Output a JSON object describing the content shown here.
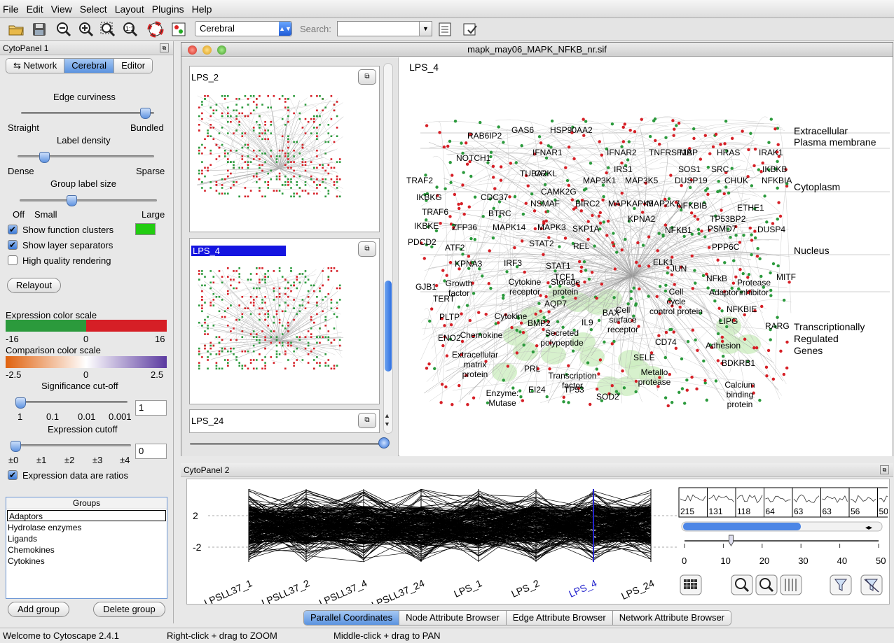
{
  "menu": [
    "File",
    "Edit",
    "View",
    "Select",
    "Layout",
    "Plugins",
    "Help"
  ],
  "toolbar": {
    "layout_combo_value": "Cerebral",
    "search_label": "Search:",
    "search_value": "",
    "icons": [
      "open-folder-icon",
      "save-icon",
      "zoom-out-icon",
      "zoom-in-icon",
      "zoom-selected-icon",
      "zoom-fit-icon",
      "lifebuoy-icon",
      "vizmapper-icon",
      "attribute-browser-icon",
      "export-icon"
    ]
  },
  "left_panel": {
    "title": "CytoPanel 1",
    "tabs": [
      "Network",
      "Cerebral",
      "Editor"
    ],
    "selected_tab": "Cerebral",
    "edge_curviness": {
      "label": "Edge curviness",
      "min_label": "Straight",
      "max_label": "Bundled",
      "value": 0.97
    },
    "label_density": {
      "label": "Label density",
      "min_label": "Dense",
      "max_label": "Sparse",
      "value": 0.17
    },
    "group_label_size": {
      "label": "Group label size",
      "tick_labels": [
        "Off",
        "Small",
        "Large"
      ],
      "value": 0.37
    },
    "show_function_clusters": {
      "label": "Show function clusters",
      "checked": true,
      "swatch_color": "#22cc11"
    },
    "show_layer_separators": {
      "label": "Show layer separators",
      "checked": true
    },
    "high_quality_rendering": {
      "label": "High quality rendering",
      "checked": false
    },
    "relayout_button": "Relayout",
    "expression_color_scale": {
      "label": "Expression color scale",
      "min": "-16",
      "mid": "0",
      "max": "16",
      "low_color": "#2b9a3c",
      "high_color": "#d61f26"
    },
    "comparison_color_scale": {
      "label": "Comparison color scale",
      "min": "-2.5",
      "mid": "0",
      "max": "2.5",
      "low_color": "#e0620f",
      "high_color": "#5b3aa0"
    },
    "significance_cutoff": {
      "label": "Significance cut-off",
      "tick_labels": [
        "1",
        "0.1",
        "0.01",
        "0.001"
      ],
      "value": 0,
      "field_value": "1"
    },
    "expression_cutoff": {
      "label": "Expression cutoff",
      "tick_labels": [
        "±0",
        "±1",
        "±2",
        "±3",
        "±4"
      ],
      "value": 0,
      "field_value": "0"
    },
    "expression_ratios": {
      "label": "Expression data are ratios",
      "checked": true
    },
    "groups": {
      "header": "Groups",
      "items": [
        "Adaptors",
        "Hydrolase enzymes",
        "Ligands",
        "Chemokines",
        "Cytokines"
      ],
      "selected": "Adaptors"
    },
    "add_group_button": "Add group",
    "delete_group_button": "Delete group"
  },
  "network_window": {
    "title": "mapk_may06_MAPK_NFKB_nr.sif",
    "thumbnails": [
      {
        "label": "LPS_2",
        "selected": false
      },
      {
        "label": "LPS_4",
        "selected": true
      },
      {
        "label": "LPS_24",
        "selected": false
      }
    ],
    "canvas_title": "LPS_4",
    "layers": [
      "Extracellular",
      "Plasma membrane",
      "Cytoplasm",
      "Nucleus",
      "Transcriptionally",
      "Regulated",
      "Genes"
    ],
    "genes": [
      "GAS6",
      "HSP90AA2",
      "RAB6IP2",
      "NOTCH1",
      "IFNAR1",
      "IFNAR2",
      "TNFRSF1A",
      "MBP",
      "HRAS",
      "IRAK1",
      "IRS1",
      "SOS1",
      "SRC",
      "IKBKB",
      "TUBA2",
      "CRKL",
      "TRAF2",
      "MAP3K1",
      "MAP3K5",
      "DUSP19",
      "CHUK",
      "NFKBIA",
      "CAMK2G",
      "IKBKG",
      "CDC37",
      "NSMAF",
      "BIRC2",
      "MAPKAPK5",
      "MAP2K7",
      "NFKBIB",
      "ETHE1",
      "TRAF6",
      "BTRC",
      "KPNA2",
      "TP53BP2",
      "IKBKE",
      "ZFP36",
      "MAPK14",
      "MAPK3",
      "SKP1A",
      "NFKB1",
      "PSMD7",
      "DUSP4",
      "PDCD2",
      "STAT2",
      "ATF2",
      "REL",
      "PPP6C",
      "KPNA3",
      "IRF3",
      "STAT1",
      "ELK1",
      "TCF1",
      "MITF",
      "JUN",
      "NFkB",
      "GJB1",
      "TERT",
      "AQP7",
      "BAX",
      "NFKBIE",
      "PLTP",
      "IL9",
      "BMP2",
      "CD74",
      "LIPG",
      "RARG",
      "ENO2",
      "SELE",
      "BDKRB1",
      "PRL",
      "EI24",
      "TP53",
      "SOD2"
    ],
    "clusters": [
      "Growth factor",
      "Cytokine receptor",
      "Storage protein",
      "Cell cycle control protein",
      "Adaptor",
      "Protease inhibitor",
      "Cytokine",
      "Cell surface receptor",
      "Chemokine",
      "Secreted polypeptide",
      "Extracellular matrix protein",
      "Adhesion",
      "Transcription factor",
      "Metallo protease",
      "Enzyme: Mutase",
      "Calcium binding protein"
    ]
  },
  "bottom_panel": {
    "title": "CytoPanel 2",
    "y_ticks": [
      "2",
      "-2"
    ],
    "conditions": [
      "LPSLL37_1",
      "LPSLL37_2",
      "LPSLL37_4",
      "LPSLL37_24",
      "LPS_1",
      "LPS_2",
      "LPS_4",
      "LPS_24"
    ],
    "highlighted_condition": "LPS_4",
    "cluster_counts": [
      "215",
      "131",
      "118",
      "64",
      "63",
      "63",
      "56",
      "50"
    ],
    "scale_ticks": [
      "0",
      "10",
      "20",
      "30",
      "40",
      "50"
    ],
    "scale_value": 12,
    "tabs": [
      "Parallel Coordinates",
      "Node Attribute Browser",
      "Edge Attribute Browser",
      "Network Attribute Browser"
    ],
    "selected_tab": "Parallel Coordinates"
  },
  "status": {
    "welcome": "Welcome to Cytoscape 2.4.1",
    "hint_zoom": "Right-click + drag  to  ZOOM",
    "hint_pan": "Middle-click + drag  to  PAN"
  }
}
